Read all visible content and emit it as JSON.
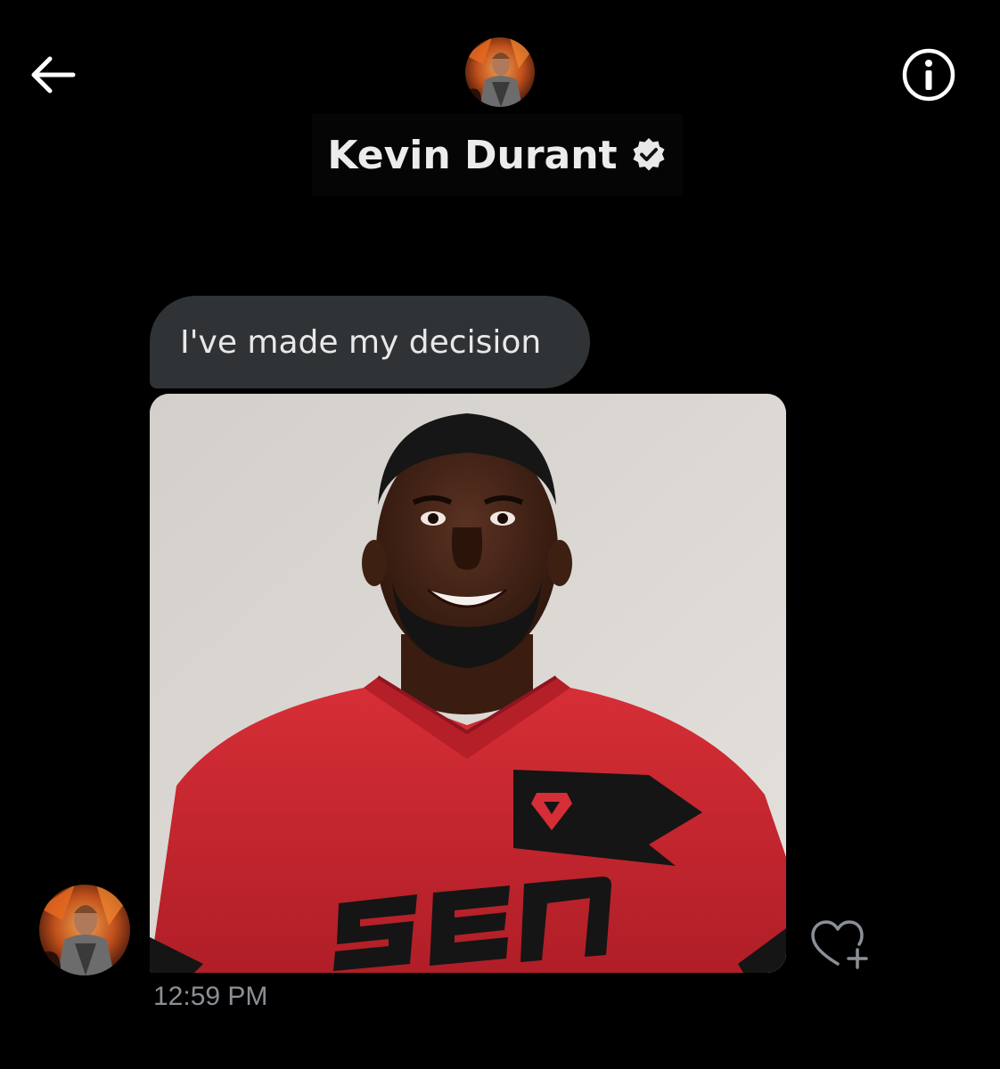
{
  "header": {
    "contact_name": "Kevin Durant",
    "verified": true,
    "back_icon": "arrow-left-icon",
    "info_icon": "info-circle-icon"
  },
  "conversation": {
    "messages": [
      {
        "type": "text",
        "text": "I've made my decision"
      },
      {
        "type": "image",
        "jersey_text": "SEN"
      }
    ],
    "timestamp": "12:59 PM",
    "reaction_icon": "heart-add-icon"
  },
  "colors": {
    "background": "#000000",
    "bubble": "#2f3336",
    "timestamp": "#8b9096",
    "jersey_red": "#c8262f"
  }
}
